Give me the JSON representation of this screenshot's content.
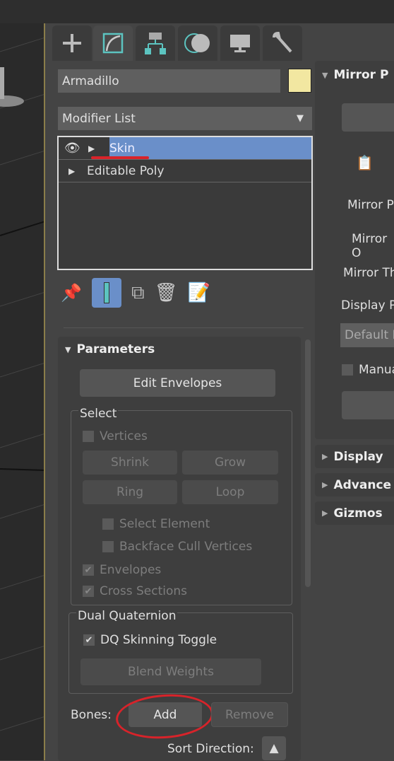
{
  "tabs": [
    {
      "name": "create",
      "icon": "plus-icon"
    },
    {
      "name": "modify",
      "icon": "modify-icon"
    },
    {
      "name": "hierarchy",
      "icon": "hierarchy-icon"
    },
    {
      "name": "motion",
      "icon": "motion-icon"
    },
    {
      "name": "display",
      "icon": "monitor-icon"
    },
    {
      "name": "utilities",
      "icon": "wrench-icon"
    }
  ],
  "object": {
    "name": "Armadillo",
    "color": "#f2e7a1"
  },
  "modifier_list": {
    "label": "Modifier List"
  },
  "stack": [
    {
      "label": "Skin",
      "selected": true
    },
    {
      "label": "Editable Poly",
      "selected": false
    }
  ],
  "parameters": {
    "title": "Parameters",
    "edit_envelopes": "Edit Envelopes",
    "select": {
      "title": "Select",
      "vertices": "Vertices",
      "shrink": "Shrink",
      "grow": "Grow",
      "ring": "Ring",
      "loop": "Loop",
      "select_element": "Select Element",
      "backface_cull": "Backface Cull Vertices",
      "envelopes": "Envelopes",
      "cross_sections": "Cross Sections"
    },
    "dual_quaternion": {
      "title": "Dual Quaternion",
      "dq_toggle": "DQ Skinning Toggle",
      "blend_weights": "Blend Weights"
    },
    "bones_label": "Bones:",
    "add": "Add",
    "remove": "Remove",
    "sort_direction": "Sort Direction:"
  },
  "right": {
    "mirror_title": "Mirror P",
    "mirror_p": "Mirror P",
    "mirror_o": "Mirror O",
    "mirror_th": "Mirror Th",
    "display_p": "Display P",
    "default_d": "Default D",
    "manual": "Manua",
    "display": "Display",
    "advanced": "Advance",
    "gizmos": "Gizmos"
  },
  "colors": {
    "selection": "#6a8fc9",
    "annotation": "#d8232a",
    "accent": "#5cc4c0"
  }
}
